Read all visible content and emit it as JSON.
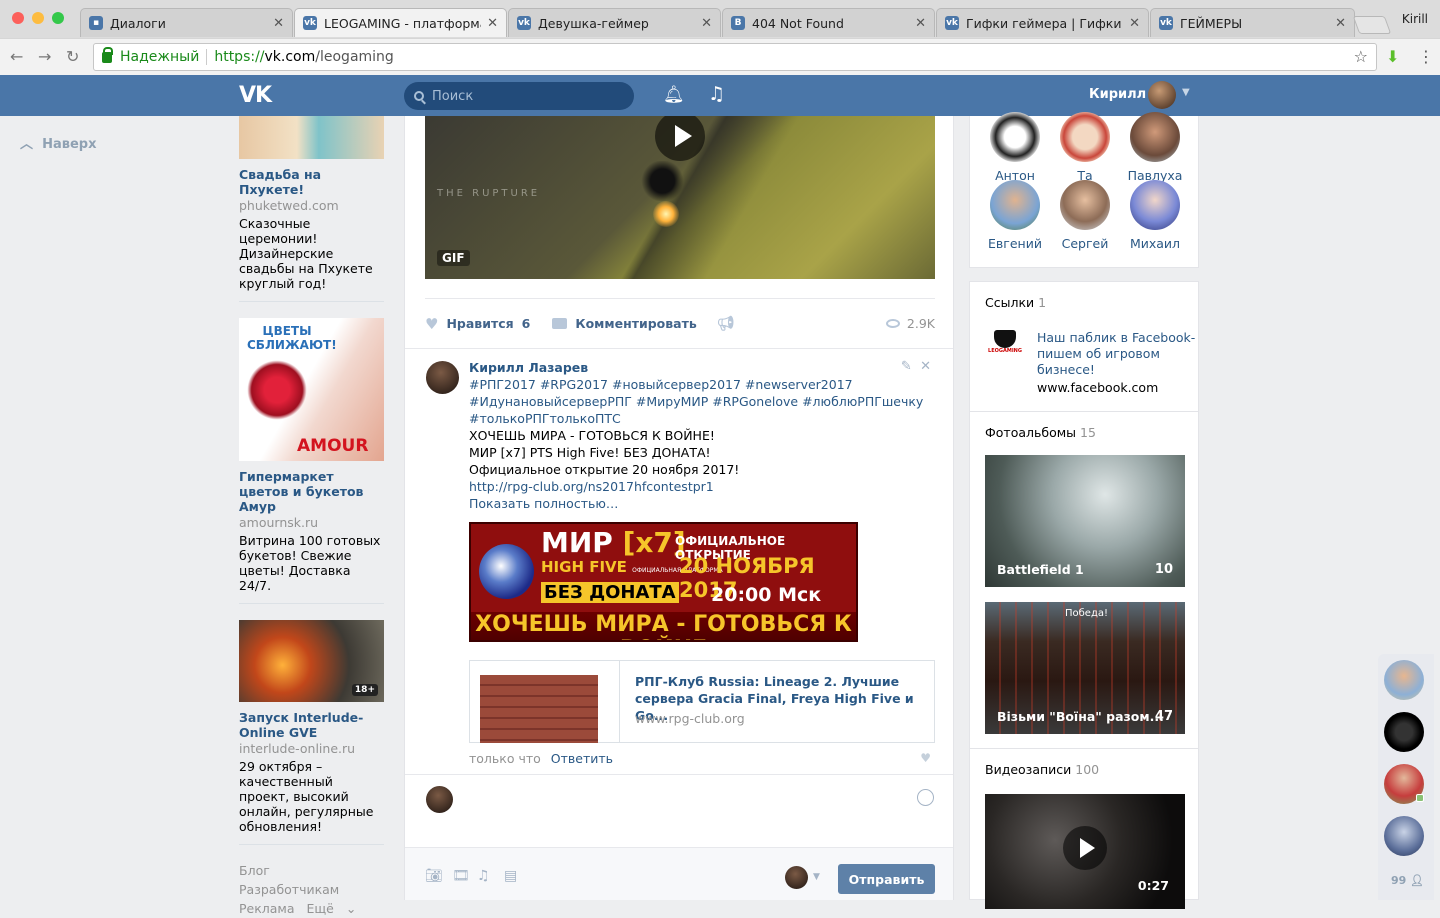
{
  "browser": {
    "profile": "Kirill",
    "tabs": [
      {
        "title": "Диалоги",
        "icon": "chat-icon",
        "active": false
      },
      {
        "title": "LEOGAMING - платформа д",
        "icon": "vk-icon",
        "active": true
      },
      {
        "title": "Девушка-геймер",
        "icon": "vk-icon",
        "active": false
      },
      {
        "title": "404 Not Found",
        "icon": "b-icon",
        "active": false
      },
      {
        "title": "Гифки геймера | Гифки из",
        "icon": "vk-icon",
        "active": false
      },
      {
        "title": "ГЕЙМЕРЫ",
        "icon": "vk-icon",
        "active": false
      }
    ],
    "url": {
      "secure_label": "Надежный",
      "scheme": "https://",
      "host": "vk.com",
      "path": "/leogaming"
    }
  },
  "header": {
    "logo": "VK",
    "search_placeholder": "Поиск",
    "user_name": "Кирилл"
  },
  "left": {
    "up_label": "Наверх"
  },
  "ads": [
    {
      "title": "Свадьба на Пхукете!",
      "domain": "phuketwed.com",
      "desc": "Сказочные церемонии! Дизайнерские свадьбы на Пхукете круглый год!"
    },
    {
      "title": "Гипермаркет цветов и букетов Амур",
      "domain": "amournsk.ru",
      "desc": "Витрина 100 готовых букетов! Свежие цветы! Доставка 24/7.",
      "image_text_1": "ЦВЕТЫ",
      "image_text_2": "СБЛИЖАЮТ!",
      "image_brand": "AMOUR"
    },
    {
      "title": "Запуск Interlude-Online GVE",
      "domain": "interlude-online.ru",
      "desc": "29 октября – качественный проект, высокий онлайн, регулярные обновления!",
      "badge": "18+"
    }
  ],
  "footer": {
    "blog": "Блог",
    "devs": "Разработчикам",
    "ads": "Реклама",
    "more": "Ещё"
  },
  "post": {
    "video_watermark": "THE RUPTURE",
    "gif_label": "GIF",
    "like_label": "Нравится",
    "like_count": "6",
    "comment_label": "Комментировать",
    "views": "2.9K"
  },
  "comment": {
    "author": "Кирилл Лазарев",
    "hashtags_1": "#РПГ2017 #RPG2017 #новыйсервер2017 #newserver2017",
    "hashtags_2": "#ИдунановыйсерверРПГ #МируМИР #RPGonelove #люблюРПГшечку",
    "hashtags_3": "#толькоРПГтолькоПТС",
    "line1": "ХОЧЕШЬ МИРА - ГОТОВЬСЯ К ВОЙНЕ!",
    "line2": "МИР [x7] PTS High Five! БЕЗ ДОНАТА!",
    "line3": "Официальное открытие 20 ноября 2017!",
    "link": "http://rpg-club.org/ns2017hfcontestpr1",
    "show_more": "Показать полностью…",
    "banner": {
      "mir": "МИР",
      "x7": "[x7]",
      "highfive": "HIGH FIVE",
      "official_platform": "ОФИЦИАЛЬНАЯ ПЛАТФОРМА",
      "no_donate": "БЕЗ ДОНАТА",
      "opening": "ОФИЦИАЛЬНОЕ ОТКРЫТИЕ",
      "date": "20 НОЯБРЯ 2017",
      "time": "20:00 Мск",
      "slogan": "ХОЧЕШЬ МИРА - ГОТОВЬСЯ К ВОЙНЕ"
    },
    "card_title": "РПГ-Клуб Russia: Lineage 2. Лучшие сервера Gracia Final, Freya High Five и Go...",
    "card_domain": "www.rpg-club.org",
    "time": "только что",
    "reply": "Ответить"
  },
  "composer": {
    "send": "Отправить"
  },
  "friends": [
    {
      "name": "Антон"
    },
    {
      "name": "Та"
    },
    {
      "name": "Павлуха"
    },
    {
      "name": "Евгений"
    },
    {
      "name": "Сергей"
    },
    {
      "name": "Михаил"
    }
  ],
  "links_block": {
    "title": "Ссылки",
    "count": "1",
    "item_title": "Наш паблик в Facebook- пишем об игровом бизнесе!",
    "item_domain": "www.facebook.com",
    "item_logo_text": "LEOGAMING"
  },
  "albums_block": {
    "title": "Фотоальбомы",
    "count": "15",
    "albums": [
      {
        "title": "Battlefield 1",
        "count": "10"
      },
      {
        "title": "Візьми \"Воїна\" разом...",
        "count": "47",
        "overlay": "Победа!"
      }
    ]
  },
  "videos_block": {
    "title": "Видеозаписи",
    "count": "100",
    "duration": "0:27"
  },
  "chat": {
    "count": "99"
  }
}
